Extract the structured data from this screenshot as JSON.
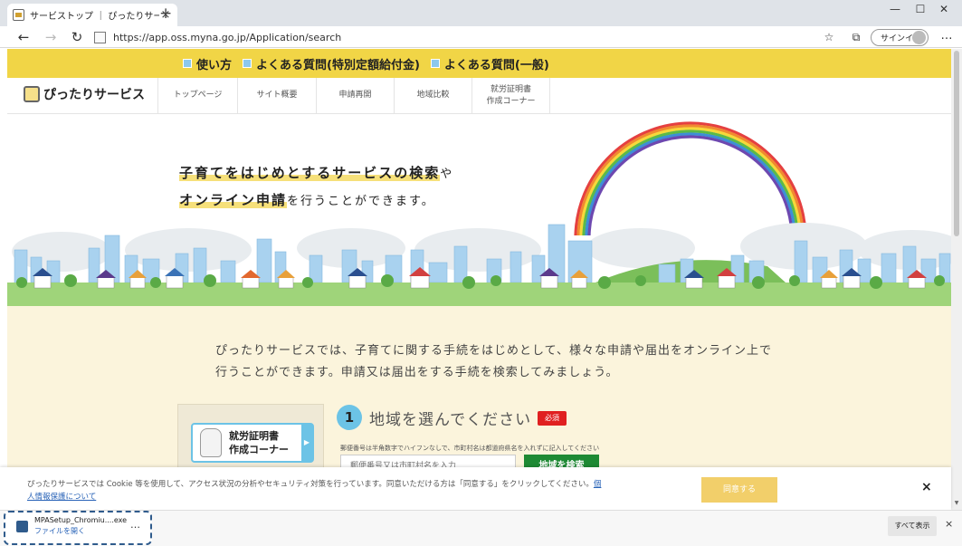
{
  "browser": {
    "tab_title": "サービストップ ｜ ぴったりサービス(Her",
    "url_host": "https://app.oss.myna.go.jp",
    "url_path": "/Application/search",
    "signin_label": "サインイン"
  },
  "top_links": [
    {
      "label": "使い方"
    },
    {
      "label": "よくある質問(特別定額給付金)"
    },
    {
      "label": "よくある質問(一般)"
    }
  ],
  "site": {
    "logo": "ぴったりサービス",
    "nav": [
      {
        "label": "トップページ"
      },
      {
        "label": "サイト概要"
      },
      {
        "label": "申請再開"
      },
      {
        "label": "地域比較"
      },
      {
        "label": "就労証明書\n作成コーナー"
      }
    ]
  },
  "hero": {
    "line1_highlight": "子育てをはじめとするサービスの検索",
    "line1_rest": "や",
    "line2_highlight": "オンライン申請",
    "line2_rest": "を行うことができます。"
  },
  "intro": {
    "line1": "ぴったりサービスでは、子育てに関する手続をはじめとして、様々な申請や届出をオンライン上で",
    "line2": "行うことができます。申請又は届出をする手続を検索してみましょう。"
  },
  "cert_corner": {
    "line1": "就労証明書",
    "line2": "作成コーナー"
  },
  "step1": {
    "number": "1",
    "title": "地域を選んでください",
    "required": "必須",
    "hint": "郵便番号は半角数字でハイフンなしで、市町村名は都道府県名を入れずに記入してください",
    "placeholder": "郵便番号又は市町村名を入力",
    "search_button": "地域を検索"
  },
  "cookie": {
    "text": "ぴったりサービスでは Cookie 等を使用して、アクセス状況の分析やセキュリティ対策を行っています。同意いただける方は「同意する」をクリックしてください。",
    "link": "個人情報保護について",
    "agree": "同意する",
    "close": "×"
  },
  "download": {
    "filename": "MPASetup_Chromiu....exe",
    "open_label": "ファイルを開く",
    "more": "…",
    "show_all": "すべて表示",
    "close": "×"
  }
}
